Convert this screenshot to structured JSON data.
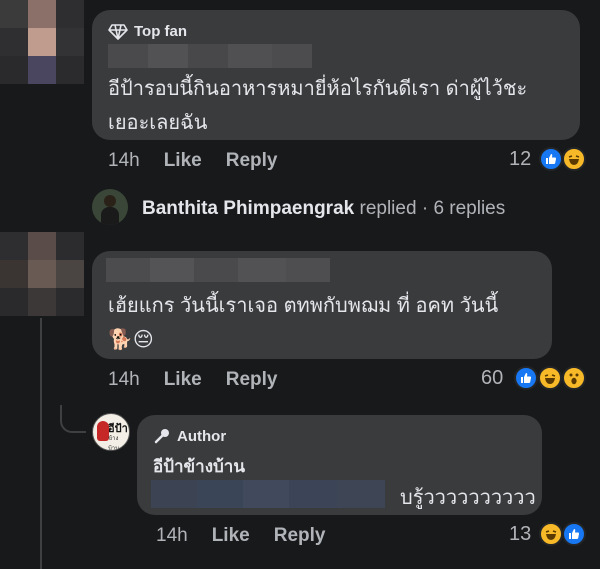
{
  "comment1": {
    "badge": "Top fan",
    "text_line1": "อีป้ารอบนี้กินอาหารหมายี่ห้อไรกันดีเรา ด่าผู้ไว้ชะ",
    "text_line2": "เยอะเลยฉัน",
    "time": "14h",
    "like": "Like",
    "reply": "Reply",
    "reaction_count": "12",
    "reactions": [
      "like-icon",
      "haha-icon"
    ]
  },
  "replies_link": {
    "name": "Banthita Phimpaengrak",
    "action": "replied",
    "separator": "·",
    "count": "6 replies"
  },
  "comment2": {
    "text_line1": "เฮ้ยแกร วันนี้เราเจอ ตทพกับพฌม ที่ อคท วันนี้",
    "emoji": "🐕😔",
    "time": "14h",
    "like": "Like",
    "reply": "Reply",
    "reaction_count": "60",
    "reactions": [
      "like-icon",
      "haha-icon",
      "wow-icon"
    ]
  },
  "reply1": {
    "badge": "Author",
    "name": "อีป้าข้างบ้าน",
    "avatar_text": "อีป้า",
    "avatar_sub": "ข้างบ้าน",
    "text_suffix": "บรู้วววววววววว",
    "time": "14h",
    "like": "Like",
    "reply": "Reply",
    "reaction_count": "13",
    "reactions": [
      "haha-icon",
      "like-icon"
    ]
  },
  "colors": {
    "background": "#18191a",
    "bubble": "#3a3b3c",
    "like": "#1877f2",
    "haha": "#f7b928"
  }
}
